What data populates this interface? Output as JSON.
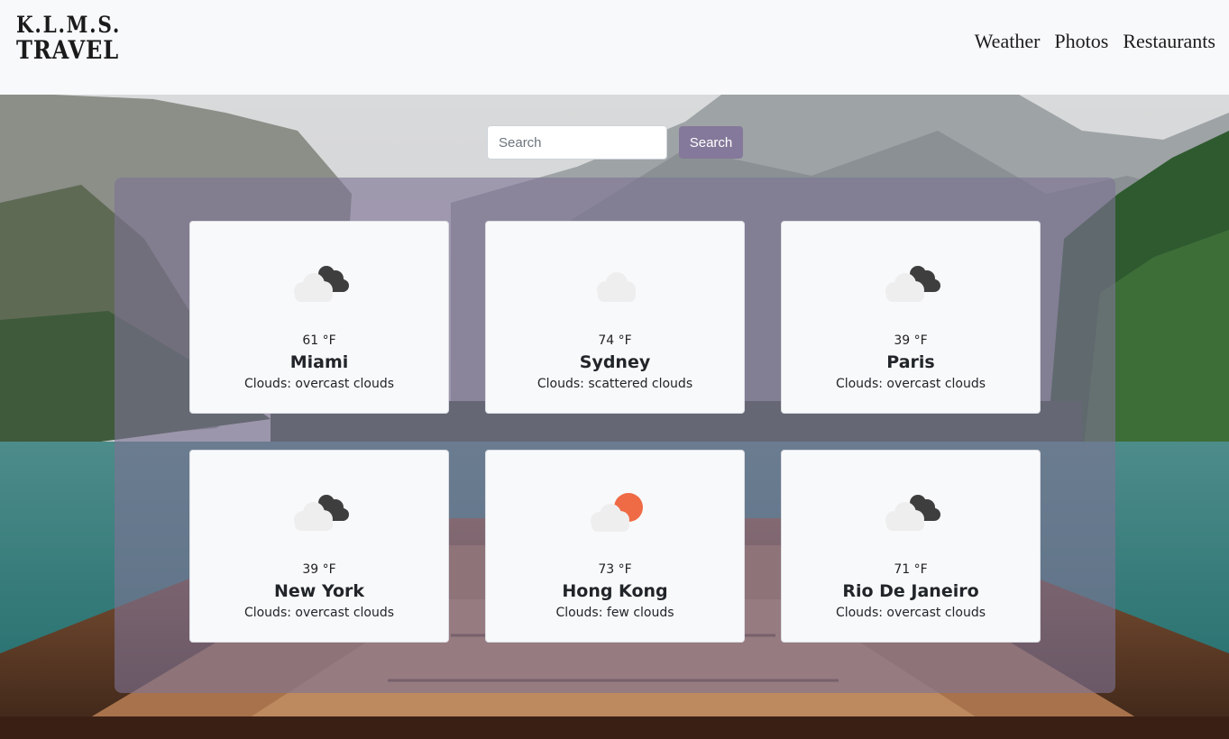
{
  "brand": {
    "line1": "K.L.M.S.",
    "line2": "TRAVEL"
  },
  "nav": {
    "items": [
      "Weather",
      "Photos",
      "Restaurants"
    ]
  },
  "search": {
    "placeholder": "Search",
    "value": "",
    "button_label": "Search"
  },
  "colors": {
    "accent": "#84799a",
    "panel": "#7e7394",
    "sun": "#ef6b45",
    "cloud_dark": "#3e3e3e",
    "cloud_light": "#eeeeee"
  },
  "cards": [
    {
      "temp": "61 °F",
      "city": "Miami",
      "desc": "Clouds: overcast clouds",
      "icon": "overcast-clouds-icon"
    },
    {
      "temp": "74 °F",
      "city": "Sydney",
      "desc": "Clouds: scattered clouds",
      "icon": "scattered-clouds-icon"
    },
    {
      "temp": "39 °F",
      "city": "Paris",
      "desc": "Clouds: overcast clouds",
      "icon": "overcast-clouds-icon"
    },
    {
      "temp": "39 °F",
      "city": "New York",
      "desc": "Clouds: overcast clouds",
      "icon": "overcast-clouds-icon"
    },
    {
      "temp": "73 °F",
      "city": "Hong Kong",
      "desc": "Clouds: few clouds",
      "icon": "few-clouds-icon"
    },
    {
      "temp": "71 °F",
      "city": "Rio De Janeiro",
      "desc": "Clouds: overcast clouds",
      "icon": "overcast-clouds-icon"
    }
  ]
}
